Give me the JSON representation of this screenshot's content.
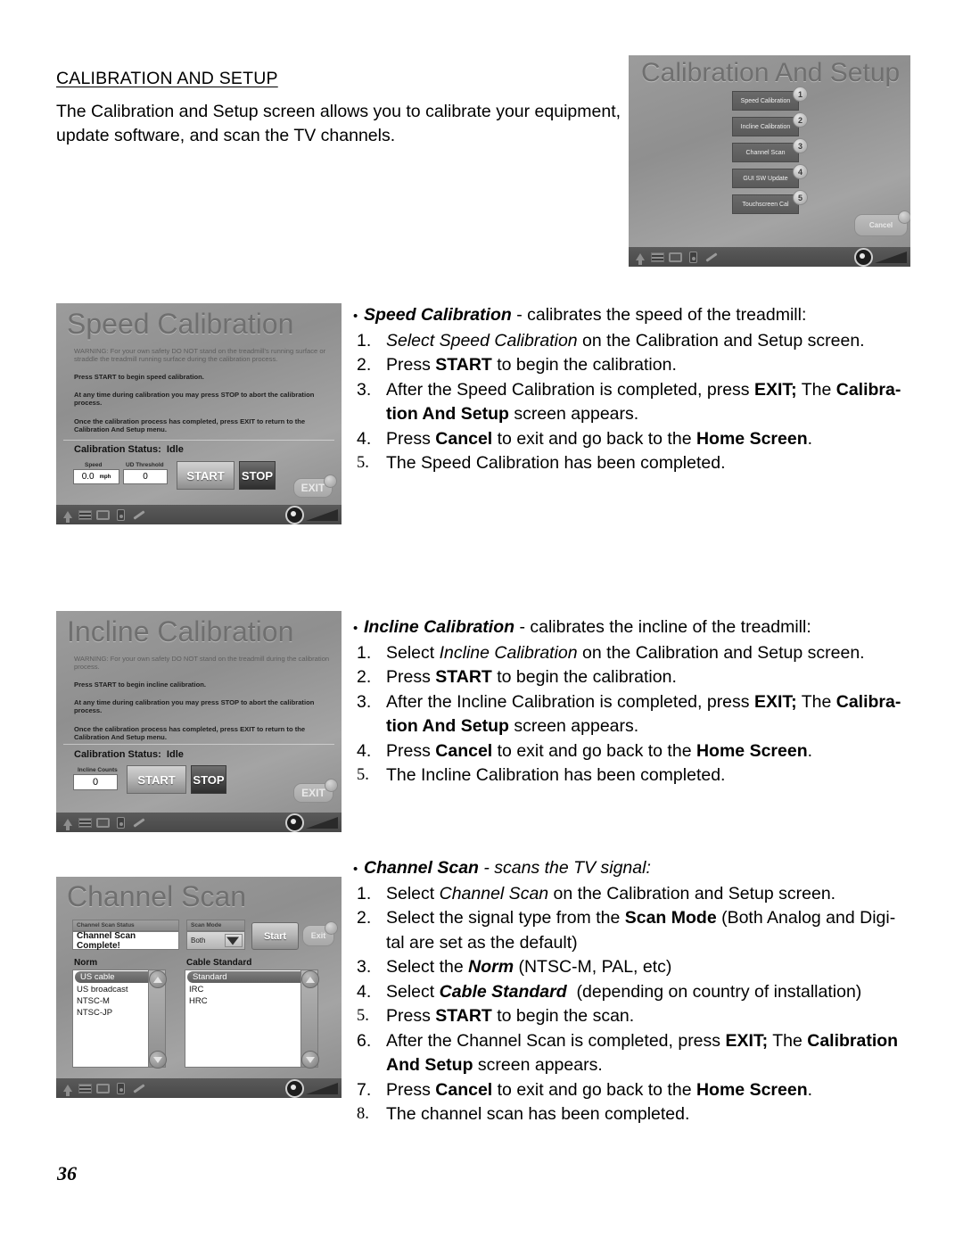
{
  "document": {
    "heading": "CALIBRATION AND SETUP",
    "intro": "The Calibration and Setup screen allows you to calibrate your equipment, update software, and scan the TV channels.",
    "page_number": "36"
  },
  "sections": {
    "speed": {
      "bullet_title": "Speed Calibration",
      "bullet_rest": " - calibrates the speed of the treadmill:",
      "steps": [
        {
          "num": "1.",
          "html": "<i>Select Speed Calibration</i> on the Calibration and Setup screen."
        },
        {
          "num": "2.",
          "html": "Press <b>START</b> to begin the calibration."
        },
        {
          "num": "3.",
          "html": "After the Speed Calibration is completed, press <b>EXIT;</b> The <b>Calibra-<br>tion And Setup</b> screen appears."
        },
        {
          "num": "4.",
          "html": "Press <b>Cancel</b> to exit and go back to the <b>Home Screen</b>."
        },
        {
          "num": "5.",
          "html": "The Speed Calibration has been completed."
        }
      ]
    },
    "incline": {
      "bullet_title": "Incline Calibration",
      "bullet_rest": " - calibrates the incline of the treadmill:",
      "steps": [
        {
          "num": "1.",
          "html": "Select <i>Incline Calibration</i> on the Calibration and Setup screen."
        },
        {
          "num": "2.",
          "html": "Press <b>START</b> to begin the calibration."
        },
        {
          "num": "3.",
          "html": "After the Incline Calibration is completed, press <b>EXIT;</b> The <b>Calibra-<br>tion And Setup</b> screen appears."
        },
        {
          "num": "4.",
          "html": "Press <b>Cancel</b> to exit and go back to the <b>Home Screen</b>."
        },
        {
          "num": "5.",
          "html": "The Incline Calibration has been completed."
        }
      ]
    },
    "channel": {
      "bullet_title": "Channel Scan",
      "bullet_rest": " - scans the TV signal:",
      "steps": [
        {
          "num": "1.",
          "html": "Select <i>Channel Scan</i> on the Calibration and Setup screen."
        },
        {
          "num": "2.",
          "html": "Select the signal type from the <b>Scan Mode</b> (Both Analog and Digi-<br>tal are set as the default)"
        },
        {
          "num": "3.",
          "html": "Select the <span class=\"bi\">Norm</span> (NTSC-M, PAL, etc)"
        },
        {
          "num": "4.",
          "html": "Select <span class=\"bi\">Cable Standard</span>&nbsp; (depending on country of installation)"
        },
        {
          "num": "5.",
          "html": "Press <b>START</b> to begin the scan."
        },
        {
          "num": "6.",
          "html": "After the Channel Scan is completed, press <b>EXIT;</b> The <b>Calibration<br>And Setup</b> screen appears."
        },
        {
          "num": "7.",
          "html": "Press <b>Cancel</b> to exit and go back to the <b>Home Screen</b>."
        },
        {
          "num": "8.",
          "html": "The channel scan has been completed."
        }
      ]
    }
  },
  "screenshots": {
    "calibration_setup": {
      "title": "Calibration And Setup",
      "menu_items": [
        {
          "label": "Speed Calibration",
          "badge": "1"
        },
        {
          "label": "Incline Calibration",
          "badge": "2"
        },
        {
          "label": "Channel Scan",
          "badge": "3"
        },
        {
          "label": "GUI SW Update",
          "badge": "4"
        },
        {
          "label": "Touchscreen Cal",
          "badge": "5"
        }
      ],
      "cancel_label": "Cancel"
    },
    "speed_calibration": {
      "title": "Speed Calibration",
      "warning": "WARNING:  For your own safety DO NOT stand on the treadmill's running surface or straddle the treadmill running surface during the calibration process.",
      "line1": "Press START to begin speed calibration.",
      "line2": "At any time during calibration you may press STOP to abort the calibration process.",
      "line3": "Once the calibration process has completed, press EXIT to return to the Calibration And Setup menu.",
      "status_label": "Calibration Status:",
      "status_value": "Idle",
      "speed_label": "Speed",
      "speed_value": "0.0",
      "speed_unit": "mph",
      "threshold_label": "UD Threshold",
      "threshold_value": "0",
      "start_label": "START",
      "stop_label": "STOP",
      "exit_label": "EXIT"
    },
    "incline_calibration": {
      "title": "Incline Calibration",
      "warning": "WARNING:  For your own safety DO NOT stand on the treadmill during the calibration process.",
      "line1": "Press START to begin incline calibration.",
      "line2": "At any time during calibration you may press STOP to abort the calibration process.",
      "line3": "Once the calibration process has completed, press EXIT to return to the Calibration And Setup menu.",
      "status_label": "Calibration Status:",
      "status_value": "Idle",
      "counts_label": "Incline Counts",
      "counts_value": "0",
      "start_label": "START",
      "stop_label": "STOP",
      "exit_label": "EXIT"
    },
    "channel_scan": {
      "title": "Channel Scan",
      "status_label": "Channel Scan Status",
      "status_value": "Channel Scan Complete!",
      "scan_mode_label": "Scan Mode",
      "scan_mode_value": "Both",
      "start_label": "Start",
      "exit_label": "Exit",
      "norm_label": "Norm",
      "norm_items": [
        "US cable",
        "US broadcast",
        "NTSC-M",
        "NTSC-JP"
      ],
      "norm_selected": "US cable",
      "cable_label": "Cable Standard",
      "cable_items": [
        "Standard",
        "IRC",
        "HRC"
      ],
      "cable_selected": "Standard"
    }
  },
  "icons": {
    "taskbar": [
      "home-icon",
      "tv-icon",
      "screen-icon",
      "ipod-icon",
      "pencil-icon",
      "headphone-icon",
      "volume-icon"
    ]
  }
}
